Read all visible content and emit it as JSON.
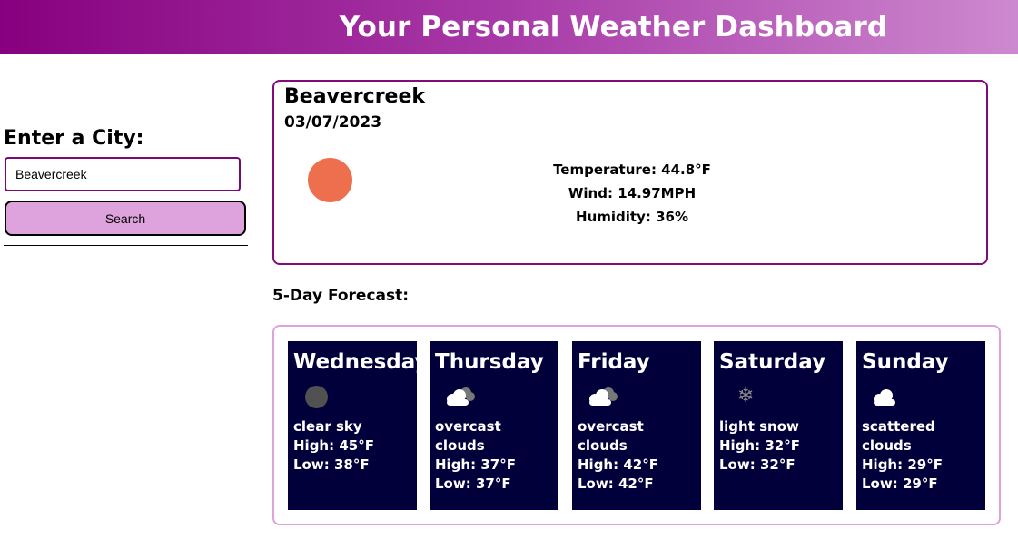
{
  "header": {
    "title": "Your Personal Weather Dashboard"
  },
  "sidebar": {
    "label": "Enter a City:",
    "input_value": "Beavercreek",
    "search_label": "Search"
  },
  "current": {
    "city": "Beavercreek",
    "date": "03/07/2023",
    "icon": "sun-icon",
    "temperature": "Temperature: 44.8°F",
    "wind": "Wind: 14.97MPH",
    "humidity": "Humidity: 36%"
  },
  "forecast": {
    "title": "5-Day Forecast:",
    "days": [
      {
        "day": "Wednesday",
        "icon": "moon-icon",
        "desc": "clear sky",
        "high": "High: 45°F",
        "low": "Low: 38°F"
      },
      {
        "day": "Thursday",
        "icon": "cloud-icon",
        "desc": "overcast clouds",
        "high": "High: 37°F",
        "low": "Low: 37°F"
      },
      {
        "day": "Friday",
        "icon": "cloud-icon",
        "desc": "overcast clouds",
        "high": "High: 42°F",
        "low": "Low: 42°F"
      },
      {
        "day": "Saturday",
        "icon": "snowflake-icon",
        "desc": "light snow",
        "high": "High: 32°F",
        "low": "Low: 32°F"
      },
      {
        "day": "Sunday",
        "icon": "cloud-icon",
        "desc": "scattered clouds",
        "high": "High: 29°F",
        "low": "Low: 29°F"
      }
    ]
  },
  "colors": {
    "header_start": "#87007f",
    "header_end": "#cd89cf",
    "card_bg": "#02003b",
    "search_btn": "#dea2dd",
    "sun": "#ee6f4e"
  }
}
